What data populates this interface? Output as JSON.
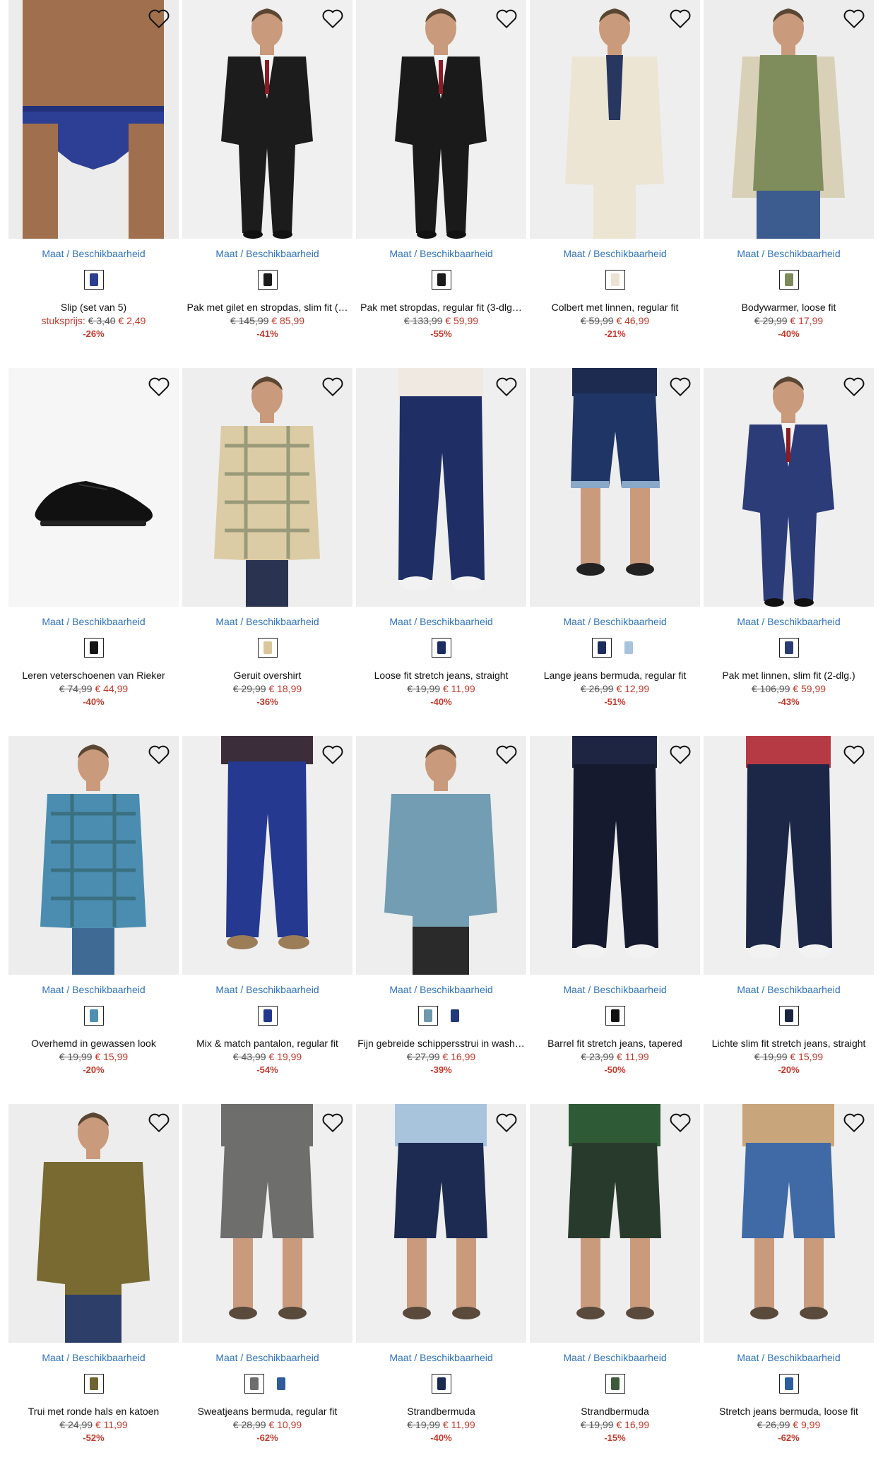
{
  "availability_label_left": "Maat",
  "availability_separator": " / ",
  "availability_label_right": "Beschikbaarheid",
  "products": [
    {
      "title": "Slip (set van 5)",
      "price_label": "stuksprijs:",
      "old_price": "€ 3,40",
      "new_price": "€ 2,49",
      "discount": "-26%",
      "swatches": [
        "#2a3f8f"
      ],
      "colors": {
        "top": "#a0704e",
        "bottom": "#2c3f94",
        "bg": "#ececec"
      },
      "type": "brief"
    },
    {
      "title": "Pak met gilet en stropdas, slim fit (…",
      "price_label": "",
      "old_price": "€ 145,99",
      "new_price": "€ 85,99",
      "discount": "-41%",
      "swatches": [
        "#1b1b1b"
      ],
      "colors": {
        "top": "#1c1c1c",
        "bottom": "#1c1c1c",
        "bg": "#f0f0f0"
      },
      "type": "suit"
    },
    {
      "title": "Pak met stropdas, regular fit (3-dlg…",
      "price_label": "",
      "old_price": "€ 133,99",
      "new_price": "€ 59,99",
      "discount": "-55%",
      "swatches": [
        "#1b1b1b"
      ],
      "colors": {
        "top": "#1a1a1a",
        "bottom": "#1a1a1a",
        "bg": "#f0f0f0"
      },
      "type": "suit"
    },
    {
      "title": "Colbert met linnen, regular fit",
      "price_label": "",
      "old_price": "€ 59,99",
      "new_price": "€ 46,99",
      "discount": "-21%",
      "swatches": [
        "#ebe4d3"
      ],
      "colors": {
        "top": "#ece5d4",
        "bottom": "#ece5d4",
        "bg": "#eeeeee"
      },
      "type": "jacket"
    },
    {
      "title": "Bodywarmer, loose fit",
      "price_label": "",
      "old_price": "€ 29,99",
      "new_price": "€ 17,99",
      "discount": "-40%",
      "swatches": [
        "#7d8a5a"
      ],
      "colors": {
        "top": "#7f8c5c",
        "bottom": "#3c5b8e",
        "bg": "#ededed"
      },
      "type": "vest"
    },
    {
      "title": "Leren veterschoenen van Rieker",
      "price_label": "",
      "old_price": "€ 74,99",
      "new_price": "€ 44,99",
      "discount": "-40%",
      "swatches": [
        "#141414"
      ],
      "colors": {
        "top": "#111111",
        "bottom": "#111111",
        "bg": "#f6f6f6"
      },
      "type": "shoe"
    },
    {
      "title": "Geruit overshirt",
      "price_label": "",
      "old_price": "€ 29,99",
      "new_price": "€ 18,99",
      "discount": "-36%",
      "swatches": [
        "#d9c79a"
      ],
      "colors": {
        "top": "#dccca5",
        "bottom": "#2a3350",
        "bg": "#eeeeee"
      },
      "type": "shirt"
    },
    {
      "title": "Loose fit stretch jeans, straight",
      "price_label": "",
      "old_price": "€ 19,99",
      "new_price": "€ 11,99",
      "discount": "-40%",
      "swatches": [
        "#1d2d63"
      ],
      "colors": {
        "top": "#efe9e2",
        "bottom": "#1f2f66",
        "bg": "#efefef"
      },
      "type": "jeans"
    },
    {
      "title": "Lange jeans bermuda, regular fit",
      "price_label": "",
      "old_price": "€ 26,99",
      "new_price": "€ 12,99",
      "discount": "-51%",
      "swatches": [
        "#1f2d5c",
        "#a7c4dc"
      ],
      "colors": {
        "top": "#1c2b4f",
        "bottom": "#1e3566",
        "bg": "#eeeeee"
      },
      "type": "bermuda"
    },
    {
      "title": "Pak met linnen, slim fit (2-dlg.)",
      "price_label": "",
      "old_price": "€ 106,99",
      "new_price": "€ 59,99",
      "discount": "-43%",
      "swatches": [
        "#2a3c75"
      ],
      "colors": {
        "top": "#2c3c78",
        "bottom": "#2c3c78",
        "bg": "#efefef"
      },
      "type": "suit"
    },
    {
      "title": "Overhemd in gewassen look",
      "price_label": "",
      "old_price": "€ 19,99",
      "new_price": "€ 15,99",
      "discount": "-20%",
      "swatches": [
        "#4f8fb0"
      ],
      "colors": {
        "top": "#4b8db0",
        "bottom": "#3e6a94",
        "bg": "#ededed"
      },
      "type": "shirt"
    },
    {
      "title": "Mix & match pantalon, regular fit",
      "price_label": "",
      "old_price": "€ 43,99",
      "new_price": "€ 19,99",
      "discount": "-54%",
      "swatches": [
        "#22388f"
      ],
      "colors": {
        "top": "#3b2e3a",
        "bottom": "#24398f",
        "bg": "#efefef"
      },
      "type": "pants"
    },
    {
      "title": "Fijn gebreide schippersstrui in wash…",
      "price_label": "",
      "old_price": "€ 27,99",
      "new_price": "€ 16,99",
      "discount": "-39%",
      "swatches": [
        "#6e98ad",
        "#223a7a"
      ],
      "colors": {
        "top": "#729db2",
        "bottom": "#2a2a2a",
        "bg": "#eeeeee"
      },
      "type": "sweater"
    },
    {
      "title": "Barrel fit stretch jeans, tapered",
      "price_label": "",
      "old_price": "€ 23,99",
      "new_price": "€ 11,99",
      "discount": "-50%",
      "swatches": [
        "#111111"
      ],
      "colors": {
        "top": "#1e2542",
        "bottom": "#151a2e",
        "bg": "#efefef"
      },
      "type": "jeans"
    },
    {
      "title": "Lichte slim fit stretch jeans, straight",
      "price_label": "",
      "old_price": "€ 19,99",
      "new_price": "€ 15,99",
      "discount": "-20%",
      "swatches": [
        "#1b2440"
      ],
      "colors": {
        "top": "#b63a44",
        "bottom": "#1c2646",
        "bg": "#efefef"
      },
      "type": "jeans"
    },
    {
      "title": "Trui met ronde hals en katoen",
      "price_label": "",
      "old_price": "€ 24,99",
      "new_price": "€ 11,99",
      "discount": "-52%",
      "swatches": [
        "#6f6431"
      ],
      "colors": {
        "top": "#786a30",
        "bottom": "#2d3f68",
        "bg": "#ededed"
      },
      "type": "sweater"
    },
    {
      "title": "Sweatjeans bermuda, regular fit",
      "price_label": "",
      "old_price": "€ 28,99",
      "new_price": "€ 10,99",
      "discount": "-62%",
      "swatches": [
        "#6d6d6d",
        "#2f5b9e"
      ],
      "colors": {
        "top": "#6e6e6c",
        "bottom": "#6e6e6c",
        "bg": "#efefef"
      },
      "type": "shorts"
    },
    {
      "title": "Strandbermuda",
      "price_label": "",
      "old_price": "€ 19,99",
      "new_price": "€ 11,99",
      "discount": "-40%",
      "swatches": [
        "#1c2a4f"
      ],
      "colors": {
        "top": "#a8c4dc",
        "bottom": "#1d2b52",
        "bg": "#efefef"
      },
      "type": "shorts"
    },
    {
      "title": "Strandbermuda",
      "price_label": "",
      "old_price": "€ 19,99",
      "new_price": "€ 16,99",
      "discount": "-15%",
      "swatches": [
        "#3c5a3a"
      ],
      "colors": {
        "top": "#2f5a36",
        "bottom": "#283a2c",
        "bg": "#eeeeee"
      },
      "type": "shorts"
    },
    {
      "title": "Stretch jeans bermuda, loose fit",
      "price_label": "",
      "old_price": "€ 26,99",
      "new_price": "€ 9,99",
      "discount": "-62%",
      "swatches": [
        "#2c5ea0"
      ],
      "colors": {
        "top": "#c9a57c",
        "bottom": "#3f6aa6",
        "bg": "#efefef"
      },
      "type": "shorts"
    }
  ]
}
